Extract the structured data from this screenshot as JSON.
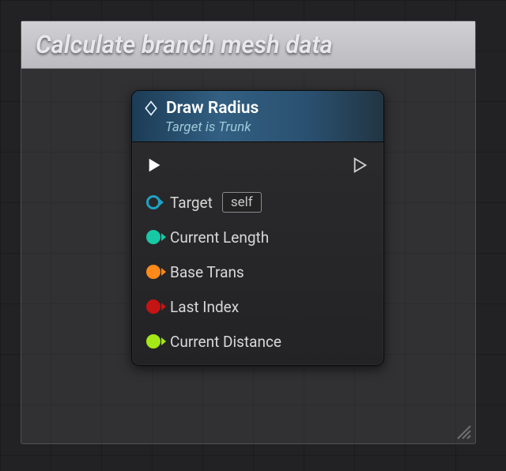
{
  "colors": {
    "target": "#1ea2c2",
    "length": "#17c9a4",
    "trans": "#ff8a1a",
    "index": "#c51414",
    "dist": "#a4e817"
  },
  "comment": {
    "title": "Calculate branch mesh data"
  },
  "node": {
    "title": "Draw Radius",
    "subtitle": "Target is Trunk",
    "target_label": "Target",
    "target_default": "self",
    "pins": [
      {
        "label": "Current Length",
        "colorKey": "length",
        "filled": true
      },
      {
        "label": "Base Trans",
        "colorKey": "trans",
        "filled": true
      },
      {
        "label": "Last Index",
        "colorKey": "index",
        "filled": true
      },
      {
        "label": "Current Distance",
        "colorKey": "dist",
        "filled": true
      }
    ]
  }
}
